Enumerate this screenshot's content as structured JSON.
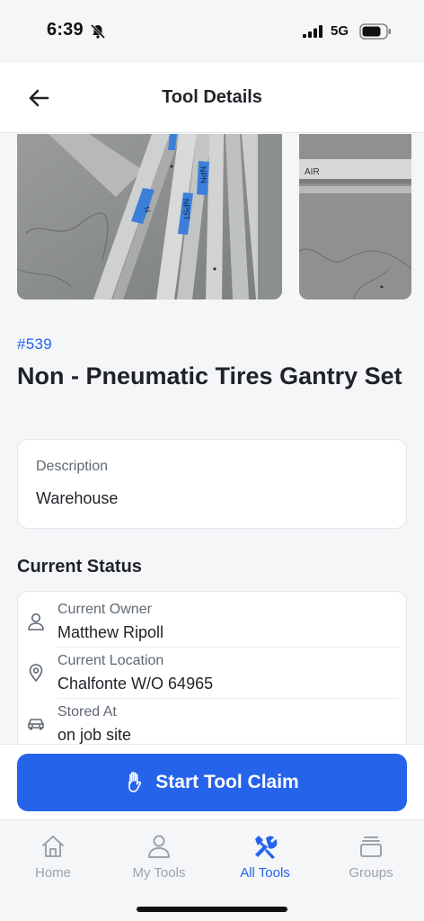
{
  "status_bar": {
    "time": "6:39",
    "network": "5G"
  },
  "header": {
    "title": "Tool Details"
  },
  "photos": [
    {
      "label_1": "NPN",
      "label_2": "NPST",
      "label_3": "N"
    },
    {
      "label_1": "AIR"
    }
  ],
  "tool": {
    "number": "#539",
    "name": "Non - Pneumatic Tires Gantry Set"
  },
  "description": {
    "label": "Description",
    "value": "Warehouse"
  },
  "current_status": {
    "title": "Current Status",
    "rows": [
      {
        "label": "Current Owner",
        "value": "Matthew Ripoll",
        "icon": "person-icon"
      },
      {
        "label": "Current Location",
        "value": "Chalfonte W/O 64965",
        "icon": "location-pin-icon"
      },
      {
        "label": "Stored At",
        "value": "on job site",
        "icon": "car-icon"
      }
    ]
  },
  "cta": {
    "label": "Start Tool Claim",
    "icon": "hand-icon"
  },
  "tabs": [
    {
      "label": "Home",
      "icon": "home-icon",
      "active": false
    },
    {
      "label": "My Tools",
      "icon": "user-icon",
      "active": false
    },
    {
      "label": "All Tools",
      "icon": "tools-icon",
      "active": true
    },
    {
      "label": "Groups",
      "icon": "stack-icon",
      "active": false
    }
  ],
  "colors": {
    "accent": "#2563eb",
    "inactive": "#9ca3ab",
    "background": "#f5f6f8"
  }
}
